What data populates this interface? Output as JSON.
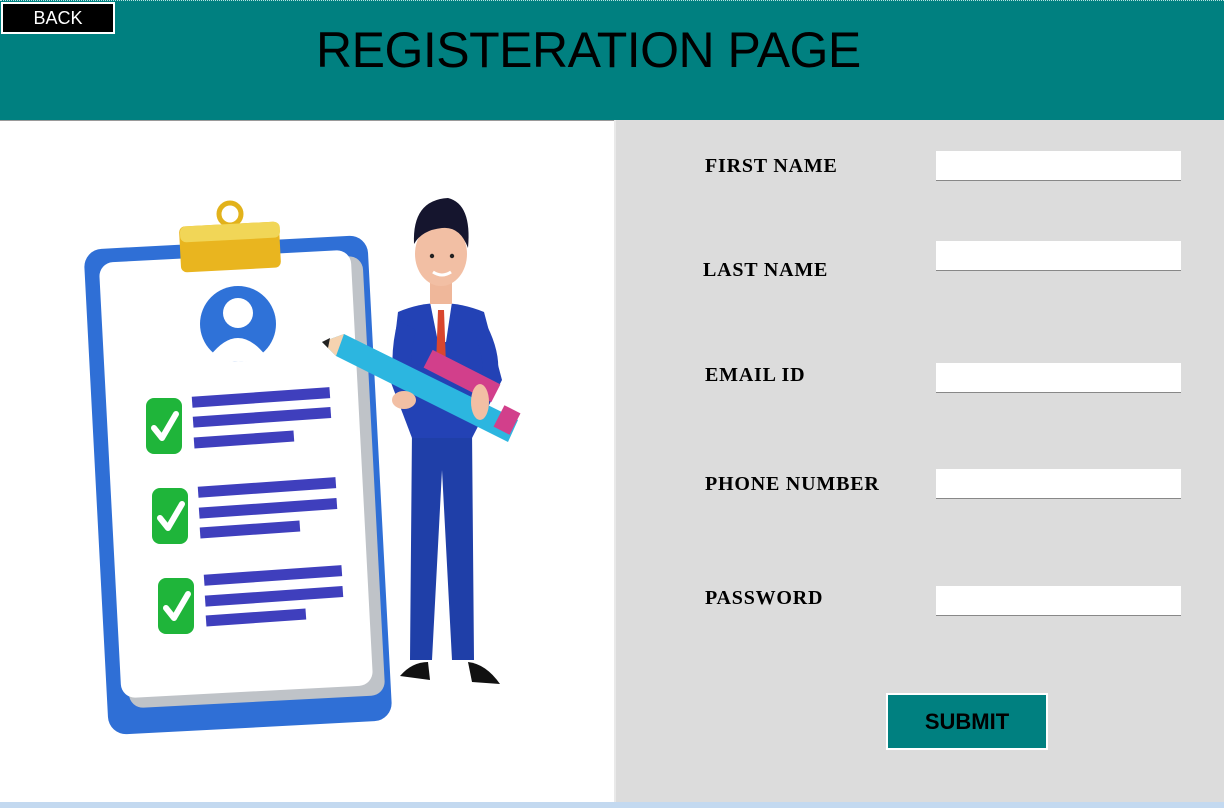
{
  "header": {
    "back_label": "BACK",
    "title": "REGISTERATION PAGE"
  },
  "form": {
    "first_name_label": "FIRST NAME",
    "first_name_value": "",
    "last_name_label": "LAST NAME",
    "last_name_value": "",
    "email_label": "EMAIL ID",
    "email_value": "",
    "phone_label": "PHONE NUMBER",
    "phone_value": "",
    "password_label": "PASSWORD",
    "password_value": "",
    "submit_label": "SUBMIT"
  },
  "colors": {
    "header_bg": "#008080",
    "form_bg": "#dcdcdc",
    "button_bg": "#008080"
  },
  "illustration": {
    "icons": [
      "clipboard-icon",
      "user-avatar-icon",
      "checkmark-icon",
      "pencil-icon",
      "businessman-figure"
    ]
  }
}
